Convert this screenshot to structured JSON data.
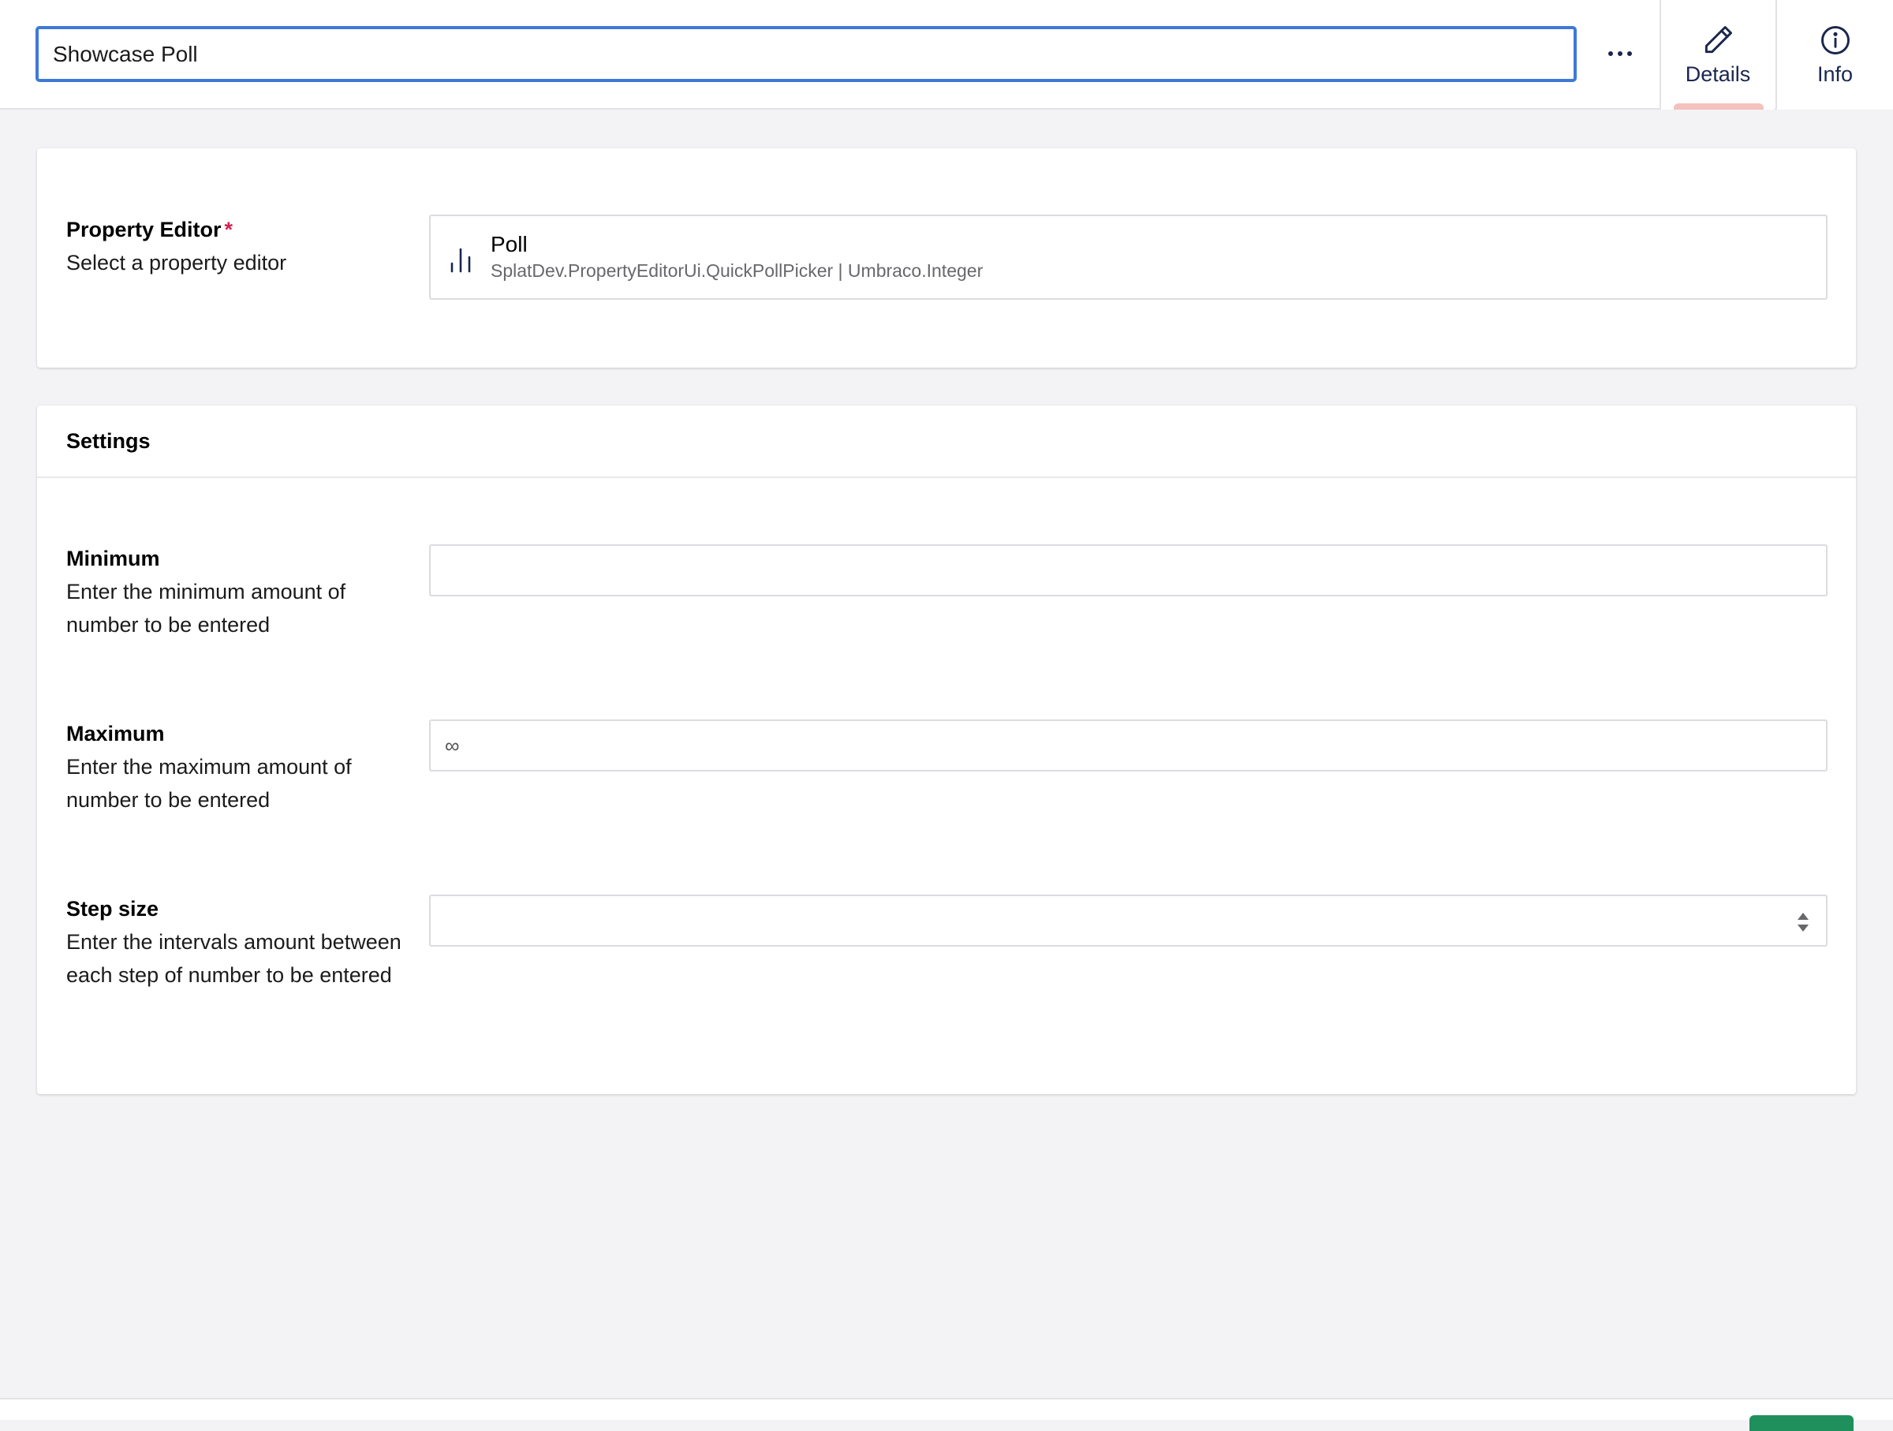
{
  "header": {
    "name_value": "Showcase Poll",
    "more_icon": "ellipsis-icon",
    "tabs": [
      {
        "label": "Details",
        "icon": "pencil-icon",
        "active": true
      },
      {
        "label": "Info",
        "icon": "info-icon",
        "active": false
      }
    ]
  },
  "editor_card": {
    "label": "Property Editor",
    "required_mark": "*",
    "description": "Select a property editor",
    "selected": {
      "icon": "poll-chart-icon",
      "name": "Poll",
      "alias": "SplatDev.PropertyEditorUi.QuickPollPicker | Umbraco.Integer"
    }
  },
  "settings": {
    "title": "Settings",
    "minimum": {
      "label": "Minimum",
      "description": "Enter the minimum amount of number to be entered",
      "value": ""
    },
    "maximum": {
      "label": "Maximum",
      "description": "Enter the maximum amount of number to be entered",
      "placeholder": "∞",
      "value": ""
    },
    "step": {
      "label": "Step size",
      "description": "Enter the intervals amount between each step of number to be entered",
      "value": ""
    }
  },
  "colors": {
    "focus_border": "#3e79d6",
    "active_tab_indicator": "#f5c1bc",
    "required": "#d42054",
    "save_button": "#1f8f5c"
  }
}
